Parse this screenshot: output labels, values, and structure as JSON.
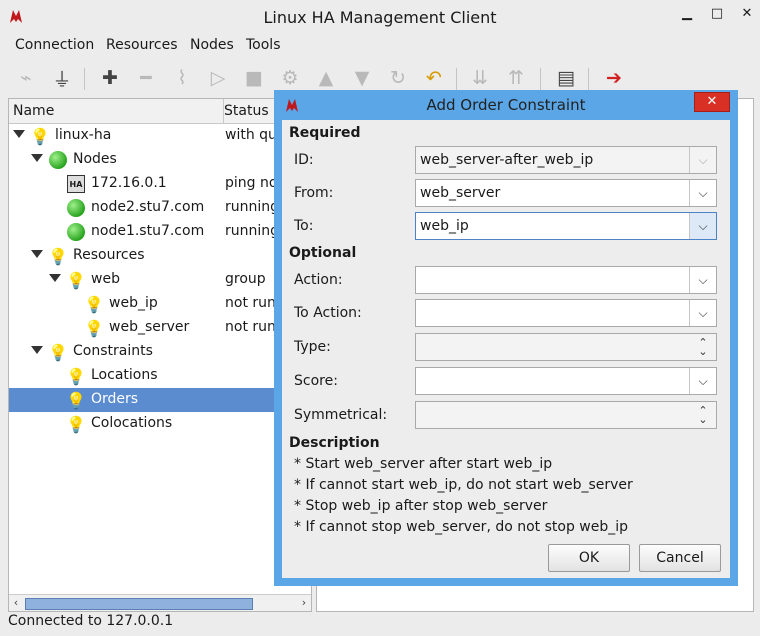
{
  "app": {
    "title": "Linux HA Management Client"
  },
  "menu": [
    "Connection",
    "Resources",
    "Nodes",
    "Tools"
  ],
  "toolbar": {
    "icons": [
      "disconnect-icon",
      "connect-icon",
      "add-icon",
      "remove-icon",
      "cleanup-icon",
      "start-icon",
      "stop-icon",
      "manage-icon",
      "move-up-icon",
      "move-down-icon",
      "migrate-icon",
      "undo-icon",
      "standby-icon",
      "active-icon",
      "view-log-icon",
      "exit-icon"
    ]
  },
  "tree": {
    "columns": [
      "Name",
      "Status"
    ],
    "rows": [
      {
        "label": "linux-ha",
        "status": "with qu",
        "indent": 0,
        "icon": "bulb",
        "twisty": true
      },
      {
        "label": "Nodes",
        "status": "",
        "indent": 1,
        "icon": "green",
        "twisty": true
      },
      {
        "label": "172.16.0.1",
        "status": "ping noc",
        "indent": 2,
        "icon": "host",
        "twisty": false
      },
      {
        "label": "node2.stu7.com",
        "status": "running",
        "indent": 2,
        "icon": "green",
        "twisty": false
      },
      {
        "label": "node1.stu7.com",
        "status": "running",
        "indent": 2,
        "icon": "green",
        "twisty": false
      },
      {
        "label": "Resources",
        "status": "",
        "indent": 1,
        "icon": "bulb",
        "twisty": true
      },
      {
        "label": "web",
        "status": "group",
        "indent": 2,
        "icon": "bulb",
        "twisty": true
      },
      {
        "label": "web_ip",
        "status": "not run",
        "indent": 3,
        "icon": "bulb",
        "twisty": false
      },
      {
        "label": "web_server",
        "status": "not run",
        "indent": 3,
        "icon": "bulb",
        "twisty": false
      },
      {
        "label": "Constraints",
        "status": "",
        "indent": 1,
        "icon": "bulb",
        "twisty": true
      },
      {
        "label": "Locations",
        "status": "",
        "indent": 2,
        "icon": "bulb",
        "twisty": false
      },
      {
        "label": "Orders",
        "status": "",
        "indent": 2,
        "icon": "bulb",
        "twisty": false,
        "selected": true
      },
      {
        "label": "Colocations",
        "status": "",
        "indent": 2,
        "icon": "bulb",
        "twisty": false
      }
    ]
  },
  "status_bar": "Connected to 127.0.0.1",
  "dialog": {
    "title": "Add Order Constraint",
    "required_label": "Required",
    "optional_label": "Optional",
    "description_label": "Description",
    "fields": {
      "id": {
        "label": "ID:",
        "value": "web_server-after_web_ip"
      },
      "from": {
        "label": "From:",
        "value": "web_server"
      },
      "to": {
        "label": "To:",
        "value": "web_ip"
      },
      "action": {
        "label": "Action:",
        "value": ""
      },
      "to_action": {
        "label": "To Action:",
        "value": ""
      },
      "type": {
        "label": "Type:",
        "value": ""
      },
      "score": {
        "label": "Score:",
        "value": ""
      },
      "symmetrical": {
        "label": "Symmetrical:",
        "value": ""
      }
    },
    "description": [
      "* Start web_server after start web_ip",
      "* If cannot start web_ip, do not start web_server",
      "* Stop web_ip after stop web_server",
      "* If cannot stop web_server, do not stop web_ip"
    ],
    "ok_label": "OK",
    "cancel_label": "Cancel"
  },
  "colors": {
    "dialog_frame": "#5aa6e6",
    "selection": "#5b8cd0",
    "close_button": "#d93025"
  }
}
